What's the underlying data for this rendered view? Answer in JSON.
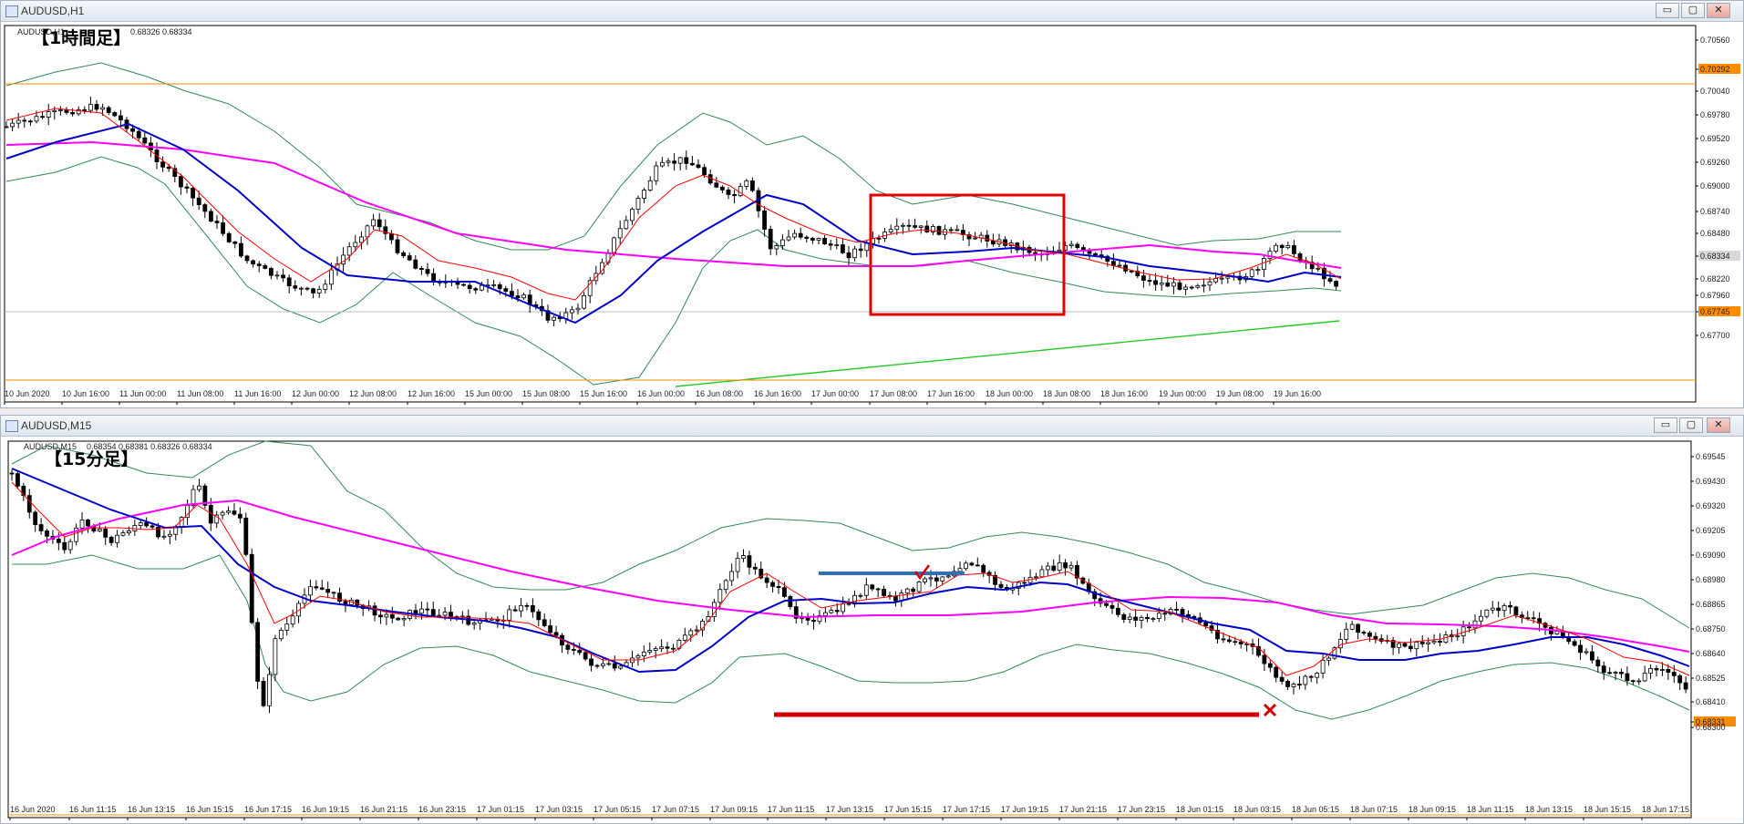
{
  "colors": {
    "bullish": "#ffffff",
    "bearish": "#000000",
    "ma_fast": "#ff0000",
    "ma_mid": "#0000c8",
    "ma_slow": "#ff00ff",
    "bollinger": "#2e8b57",
    "trendline": "#22cc22",
    "level_line": "#ff8c00",
    "annotation_box": "#e00000",
    "resistance_line": "#2f6fc0",
    "support_line": "#d40000"
  },
  "windows": [
    {
      "title": "AUDUSD,H1",
      "header_symbol": "AUDUSD,H1",
      "header_ohlc": "0.68326 0.68334",
      "label": "【1時間足】",
      "buttons": [
        "▭",
        "▢",
        "✕"
      ],
      "price_labels": [
        "0.70560",
        "0.70292",
        "0.70040",
        "0.69780",
        "0.69520",
        "0.69260",
        "0.69000",
        "0.68740",
        "0.68480",
        "0.68334",
        "0.68220",
        "0.67960",
        "0.67745",
        "0.67700"
      ],
      "highlight_labels": [
        "0.70292",
        "0.68334",
        "0.67745"
      ],
      "time_labels": [
        "10 Jun 2020",
        "10 Jun 16:00",
        "11 Jun 00:00",
        "11 Jun 08:00",
        "11 Jun 16:00",
        "12 Jun 00:00",
        "12 Jun 08:00",
        "12 Jun 16:00",
        "15 Jun 00:00",
        "15 Jun 08:00",
        "15 Jun 16:00",
        "16 Jun 00:00",
        "16 Jun 08:00",
        "16 Jun 16:00",
        "17 Jun 00:00",
        "17 Jun 08:00",
        "17 Jun 16:00",
        "18 Jun 00:00",
        "18 Jun 08:00",
        "18 Jun 16:00",
        "19 Jun 00:00",
        "19 Jun 08:00",
        "19 Jun 16:00"
      ]
    },
    {
      "title": "AUDUSD,M15",
      "header_symbol": "AUDUSD,M15",
      "header_ohlc": "0.68354 0.68381 0.68326 0.68334",
      "label": "【15分足】",
      "buttons": [
        "▭",
        "▢",
        "✕"
      ],
      "price_labels": [
        "0.69545",
        "0.69430",
        "0.69320",
        "0.69205",
        "0.69090",
        "0.68980",
        "0.68865",
        "0.68750",
        "0.68640",
        "0.68525",
        "0.68410",
        "0.68331",
        "0.68300"
      ],
      "highlight_labels": [
        "0.68331"
      ],
      "time_labels": [
        "16 Jun 2020",
        "16 Jun 11:15",
        "16 Jun 13:15",
        "16 Jun 15:15",
        "16 Jun 17:15",
        "16 Jun 19:15",
        "16 Jun 21:15",
        "16 Jun 23:15",
        "17 Jun 01:15",
        "17 Jun 03:15",
        "17 Jun 05:15",
        "17 Jun 07:15",
        "17 Jun 09:15",
        "17 Jun 11:15",
        "17 Jun 13:15",
        "17 Jun 15:15",
        "17 Jun 17:15",
        "17 Jun 19:15",
        "17 Jun 21:15",
        "17 Jun 23:15",
        "18 Jun 01:15",
        "18 Jun 03:15",
        "18 Jun 05:15",
        "18 Jun 07:15",
        "18 Jun 09:15",
        "18 Jun 11:15",
        "18 Jun 13:15",
        "18 Jun 15:15",
        "18 Jun 17:15"
      ]
    }
  ]
}
